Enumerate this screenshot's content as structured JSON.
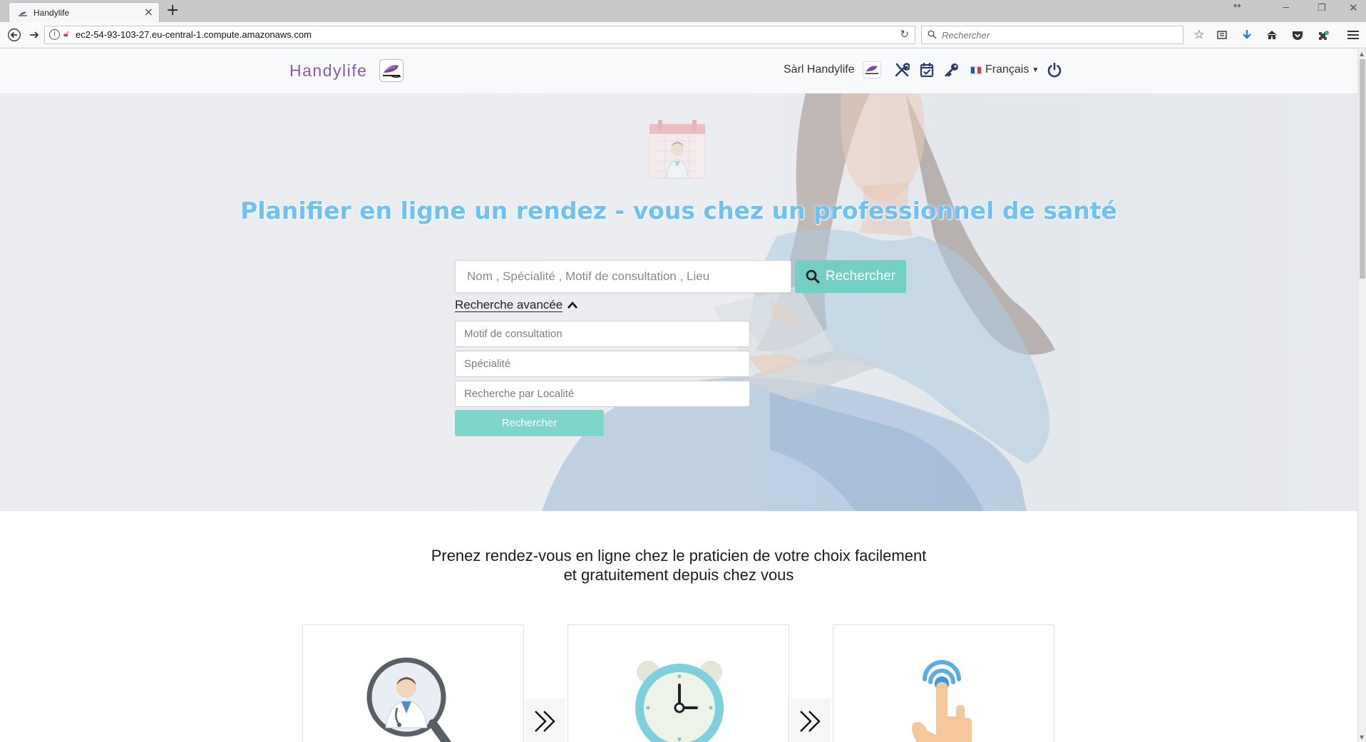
{
  "browser": {
    "tab_title": "Handylife",
    "tab_close": "×",
    "new_tab": "+",
    "url": "ec2-54-93-103-27.eu-central-1.compute.amazonaws.com",
    "search_placeholder": "Rechercher",
    "icons": [
      "back-icon",
      "forward-icon",
      "info-icon",
      "insecure-lock-icon",
      "reload-icon",
      "search-icon",
      "bookmark-star-icon",
      "reading-list-icon",
      "download-icon",
      "home-icon",
      "pocket-icon",
      "extension-icon",
      "menu-icon"
    ]
  },
  "header": {
    "brand": "Handylife",
    "user_name": "Sàrl Handylife",
    "language": "Français",
    "icons": [
      "user-avatar-icon",
      "tools-icon",
      "calendar-check-icon",
      "key-icon",
      "france-flag-icon",
      "caret-down-icon",
      "power-icon"
    ]
  },
  "hero": {
    "title": "Planifier en ligne un rendez - vous chez un professionnel de santé",
    "search_placeholder": "Nom , Spécialité , Motif de consultation , Lieu",
    "search_button": "Rechercher",
    "advanced_toggle": "Recherche avancée",
    "motif_placeholder": "Motif de consultation",
    "specialite_placeholder": "Spécialité",
    "localite_placeholder": "Recherche par Localité",
    "advanced_button": "Rechercher"
  },
  "intro": {
    "line1": "Prenez rendez-vous en ligne chez le praticien de votre choix facilement",
    "line2": "et gratuitement depuis chez vous"
  },
  "steps": [
    {
      "icon": "doctor-search-icon"
    },
    {
      "icon": "alarm-clock-icon"
    },
    {
      "icon": "tap-hand-icon"
    }
  ],
  "colors": {
    "accent_teal": "#73cfc4",
    "title_blue": "#6fc0f3",
    "brand_purple": "#8a59b0"
  }
}
